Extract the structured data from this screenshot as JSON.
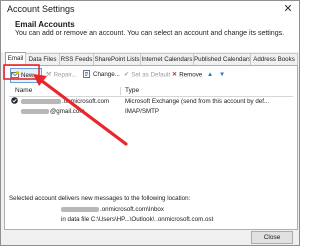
{
  "window": {
    "title": "Account Settings",
    "close_glyph": "✕"
  },
  "header": {
    "title": "Email Accounts",
    "description": "You can add or remove an account. You can select an account and change its settings."
  },
  "tabs": [
    {
      "label": "Email",
      "active": true
    },
    {
      "label": "Data Files"
    },
    {
      "label": "RSS Feeds"
    },
    {
      "label": "SharePoint Lists"
    },
    {
      "label": "Internet Calendars"
    },
    {
      "label": "Published Calendars"
    },
    {
      "label": "Address Books"
    }
  ],
  "toolbar": {
    "new_label": "New...",
    "repair_label": "Repair...",
    "change_label": "Change...",
    "default_label": "Set as Default",
    "remove_label": "Remove"
  },
  "accounts": {
    "columns": {
      "name": "Name",
      "type": "Type"
    },
    "rows": [
      {
        "name": ".onmicrosoft.com",
        "type": "Microsoft Exchange (send from this account by def..."
      },
      {
        "name": "@gmail.com",
        "type": "IMAP/SMTP"
      }
    ]
  },
  "delivery": {
    "note": "Selected account delivers new messages to the following location:",
    "location": ".onmicrosoft.com\\Inbox",
    "data_file": "in data file C:\\Users\\HP...\\Outlook\\             .onmicrosoft.com.ost"
  },
  "footer": {
    "close_label": "Close"
  },
  "colors": {
    "annotation_arrow": "#e8262b",
    "new_button_highlight": "#e8262b"
  }
}
